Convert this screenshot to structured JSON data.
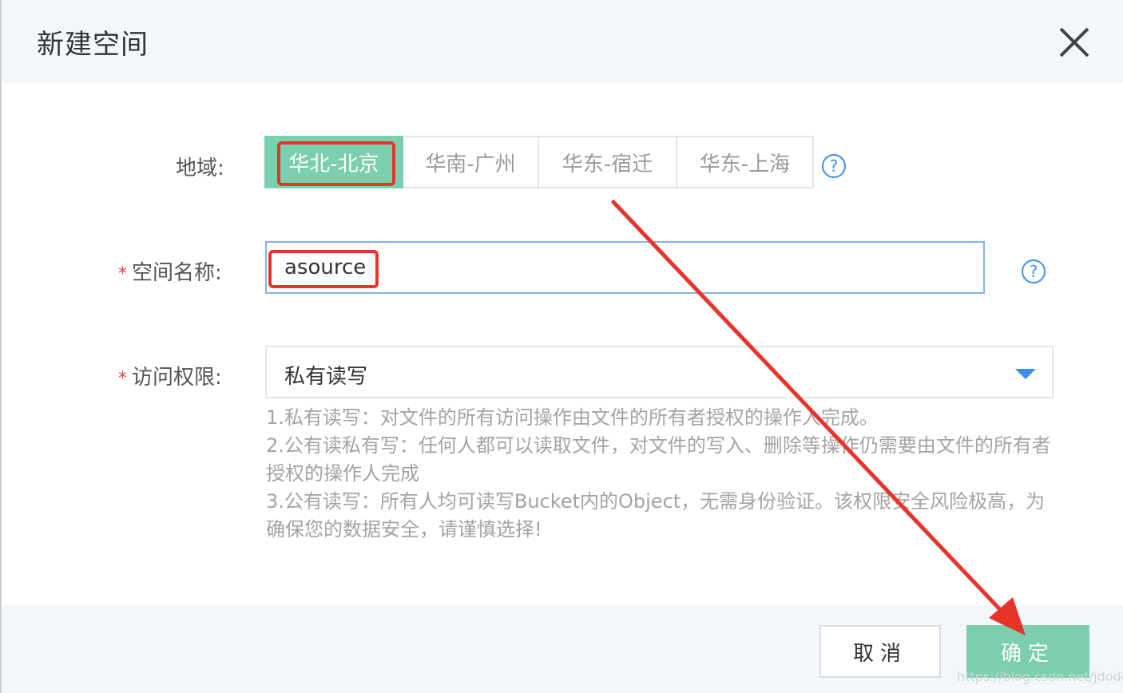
{
  "dialog": {
    "title": "新建空间",
    "close_icon": "close-icon"
  },
  "form": {
    "region": {
      "label": "地域:",
      "options": [
        "华北-北京",
        "华南-广州",
        "华东-宿迁",
        "华东-上海"
      ],
      "selected": "华北-北京",
      "help_icon": "help-icon",
      "help_glyph": "?"
    },
    "space_name": {
      "required_mark": "*",
      "label": "空间名称:",
      "value": "asource",
      "help_icon": "help-icon",
      "help_glyph": "?"
    },
    "access": {
      "required_mark": "*",
      "label": "访问权限:",
      "selected": "私有读写",
      "caret_icon": "caret-down-icon",
      "description": [
        "1.私有读写：对文件的所有访问操作由文件的所有者授权的操作人完成。",
        "2.公有读私有写：任何人都可以读取文件，对文件的写入、删除等操作仍需要由文件的所有者授权的操作人完成",
        "3.公有读写：所有人均可读写Bucket内的Object，无需身份验证。该权限安全风险极高，为确保您的数据安全，请谨慎选择!"
      ]
    }
  },
  "footer": {
    "cancel_label": "取消",
    "ok_label": "确定"
  },
  "watermark": "https://blog.csdn.net/jdodev_",
  "colors": {
    "accent_green": "#7ccfae",
    "annotation_red": "#e8332b",
    "link_blue": "#3d8ee8",
    "header_bg": "#f3f6fb"
  }
}
